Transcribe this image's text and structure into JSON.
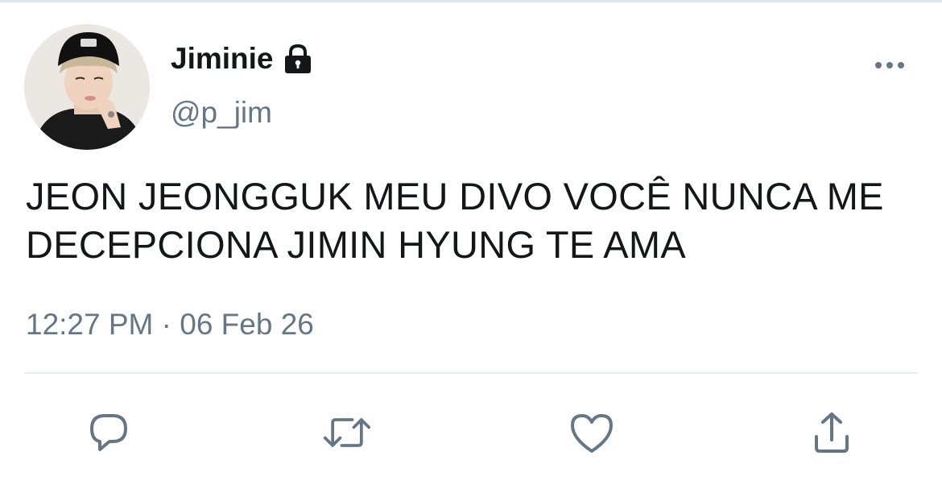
{
  "tweet": {
    "display_name": "Jiminie",
    "handle": "@p_jim",
    "text": "JEON JEONGGUK MEU DIVO VOCÊ NUNCA ME DECEPCIONA JIMIN HYUNG TE AMA",
    "timestamp": "12:27 PM · 06 Feb 26"
  },
  "icons": {
    "lock": "lock-icon",
    "more": "more-dots-icon",
    "reply": "reply-icon",
    "retweet": "retweet-icon",
    "like": "heart-icon",
    "share": "share-icon"
  },
  "colors": {
    "text": "#14171a",
    "secondary": "#657786",
    "divider": "#e6ecf0"
  }
}
